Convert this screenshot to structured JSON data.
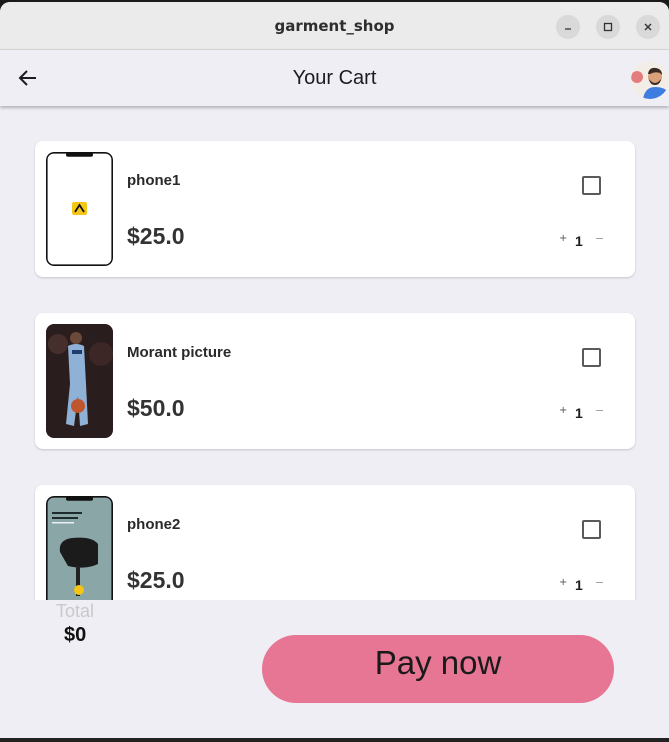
{
  "window": {
    "title": "garment_shop"
  },
  "appbar": {
    "title": "Your Cart"
  },
  "icons": {
    "back": "arrow-left-icon",
    "minimize": "minimize-icon",
    "maximize": "maximize-icon",
    "close": "close-icon",
    "avatar": "user-avatar"
  },
  "cart": {
    "items": [
      {
        "name": "phone1",
        "price": "$25.0",
        "quantity": "1",
        "plus": "+",
        "minus": "−",
        "checked": false
      },
      {
        "name": "Morant picture",
        "price": "$50.0",
        "quantity": "1",
        "plus": "+",
        "minus": "−",
        "checked": false
      },
      {
        "name": "phone2",
        "price": "$25.0",
        "quantity": "1",
        "plus": "+",
        "minus": "−",
        "checked": false
      }
    ]
  },
  "footer": {
    "total_label": "Total",
    "total_value": "$0",
    "pay_label": "Pay now"
  },
  "colors": {
    "pay_button": "#e77594",
    "background": "#f0eef5",
    "card": "#ffffff"
  }
}
